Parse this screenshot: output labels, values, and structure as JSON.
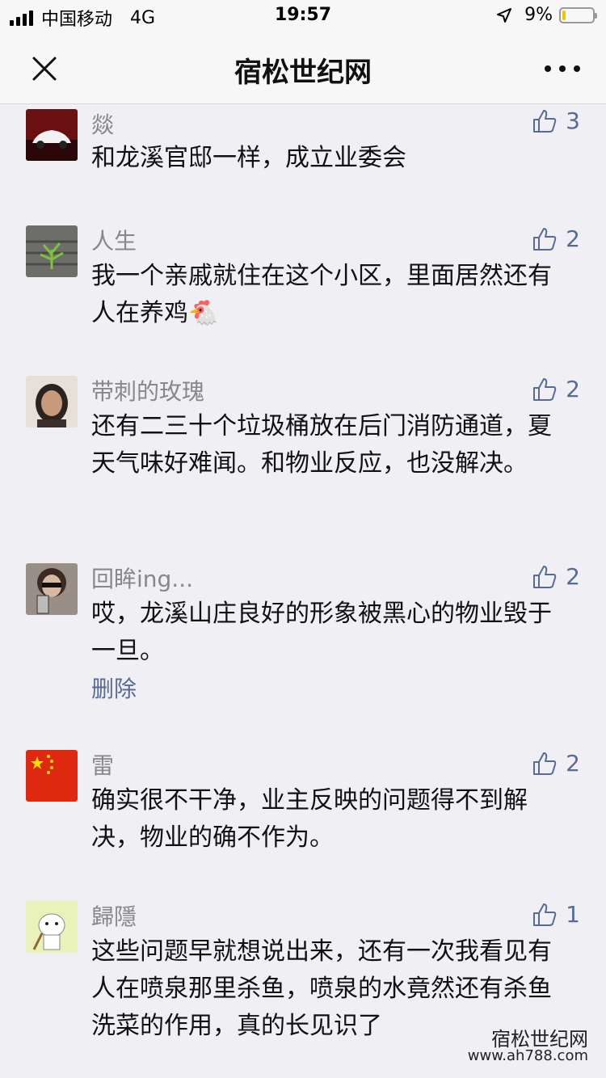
{
  "status": {
    "carrier": "中国移动",
    "network": "4G",
    "time": "19:57",
    "battery": "9%"
  },
  "nav": {
    "title": "宿松世纪网"
  },
  "comments": [
    {
      "name": "燚",
      "text": "和龙溪官邸一样，成立业委会",
      "likes": "3"
    },
    {
      "name": "人生",
      "text": "我一个亲戚就住在这个小区，里面居然还有人在养鸡🐔",
      "likes": "2"
    },
    {
      "name": "带刺的玫瑰",
      "text": "还有二三十个垃圾桶放在后门消防通道，夏天气味好难闻。和物业反应，也没解决。",
      "likes": "2"
    },
    {
      "name": "回眸ing...",
      "text": "哎，龙溪山庄良好的形象被黑心的物业毁于一旦。",
      "likes": "2",
      "delete_label": "删除"
    },
    {
      "name": "雷",
      "text": "确实很不干净，业主反映的问题得不到解决，物业的确不作为。",
      "likes": "2"
    },
    {
      "name": "歸隱",
      "text": "这些问题早就想说出来，还有一次我看见有人在喷泉那里杀鱼，喷泉的水竟然还有杀鱼洗菜的作用，真的长见识了",
      "likes": "1"
    }
  ],
  "watermark": {
    "title": "宿松世纪网",
    "url": "www.ah788.com"
  },
  "colors": {
    "link": "#576b95",
    "background": "#efeff4"
  }
}
